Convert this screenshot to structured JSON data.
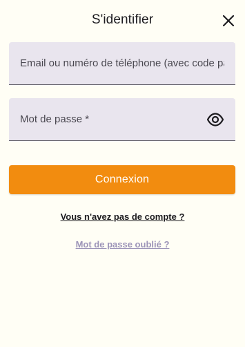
{
  "header": {
    "title": "S'identifier",
    "close_icon": "close-icon"
  },
  "form": {
    "email": {
      "placeholder": "Email ou numéro de téléphone (avec code pays +XX)",
      "value": ""
    },
    "password": {
      "placeholder": "Mot de passe *",
      "value": "",
      "toggle_icon": "eye-icon"
    },
    "submit_label": "Connexion"
  },
  "links": {
    "signup": "Vous n'avez pas de compte ?",
    "forgot": "Mot de passe oublié ?"
  },
  "colors": {
    "background": "#fffef5",
    "field_background": "#e9e5ee",
    "accent": "#f28c0f",
    "link_muted": "#9c94b8"
  }
}
